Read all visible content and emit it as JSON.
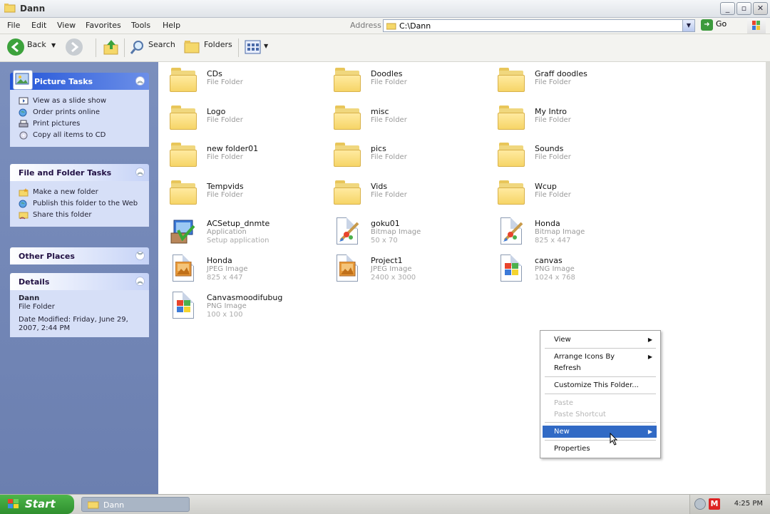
{
  "window": {
    "title": "Dann"
  },
  "menu": [
    "File",
    "Edit",
    "View",
    "Favorites",
    "Tools",
    "Help"
  ],
  "address": {
    "label": "Address",
    "value": "C:\\Dann",
    "go_label": "Go"
  },
  "toolbar": {
    "back_label": "Back",
    "search_label": "Search",
    "folders_label": "Folders"
  },
  "left_panels": {
    "picture_tasks": {
      "title": "Picture Tasks",
      "items": [
        "View as a slide show",
        "Order prints online",
        "Print pictures",
        "Copy all items to CD"
      ]
    },
    "file_folder_tasks": {
      "title": "File and Folder Tasks",
      "items": [
        "Make a new folder",
        "Publish this folder to the Web",
        "Share this folder"
      ]
    },
    "other_places": {
      "title": "Other Places"
    },
    "details": {
      "title": "Details",
      "name": "Dann",
      "type": "File Folder",
      "modified": "Date Modified: Friday, June 29, 2007, 2:44 PM"
    }
  },
  "items": [
    {
      "name": "CDs",
      "type": "File Folder",
      "kind": "folder"
    },
    {
      "name": "Doodles",
      "type": "File Folder",
      "kind": "folder"
    },
    {
      "name": "Graff doodles",
      "type": "File Folder",
      "kind": "folder"
    },
    {
      "name": "Logo",
      "type": "File Folder",
      "kind": "folder"
    },
    {
      "name": "misc",
      "type": "File Folder",
      "kind": "folder"
    },
    {
      "name": "My Intro",
      "type": "File Folder",
      "kind": "folder"
    },
    {
      "name": "new folder01",
      "type": "File Folder",
      "kind": "folder"
    },
    {
      "name": "pics",
      "type": "File Folder",
      "kind": "folder"
    },
    {
      "name": "Sounds",
      "type": "File Folder",
      "kind": "folder"
    },
    {
      "name": "Tempvids",
      "type": "File Folder",
      "kind": "folder"
    },
    {
      "name": "Vids",
      "type": "File Folder",
      "kind": "folder"
    },
    {
      "name": "Wcup",
      "type": "File Folder",
      "kind": "folder"
    },
    {
      "name": "ACSetup_dnmte",
      "type": "Application",
      "dims": "Setup application",
      "kind": "app"
    },
    {
      "name": "goku01",
      "type": "Bitmap Image",
      "dims": "50 x 70",
      "kind": "bitmap"
    },
    {
      "name": "Honda",
      "type": "Bitmap Image",
      "dims": "825 x 447",
      "kind": "bitmap"
    },
    {
      "name": "Honda",
      "type": "JPEG Image",
      "dims": "825 x 447",
      "kind": "jpeg"
    },
    {
      "name": "Project1",
      "type": "JPEG Image",
      "dims": "2400 x 3000",
      "kind": "jpeg"
    },
    {
      "name": "canvas",
      "type": "PNG Image",
      "dims": "1024 x 768",
      "kind": "png"
    },
    {
      "name": "Canvasmoodifubug",
      "type": "PNG Image",
      "dims": "100 x 100",
      "kind": "png"
    }
  ],
  "context_menu": {
    "view": "View",
    "arrange": "Arrange Icons By",
    "refresh": "Refresh",
    "customize": "Customize This Folder...",
    "paste": "Paste",
    "paste_shortcut": "Paste Shortcut",
    "new": "New",
    "properties": "Properties"
  },
  "taskbar": {
    "start_label": "Start",
    "window_label": "Dann",
    "clock": "4:25 PM"
  },
  "colors": {
    "left_pane": "#7b8fbd",
    "highlight": "#316ac5",
    "start_green": "#3aa33a"
  }
}
